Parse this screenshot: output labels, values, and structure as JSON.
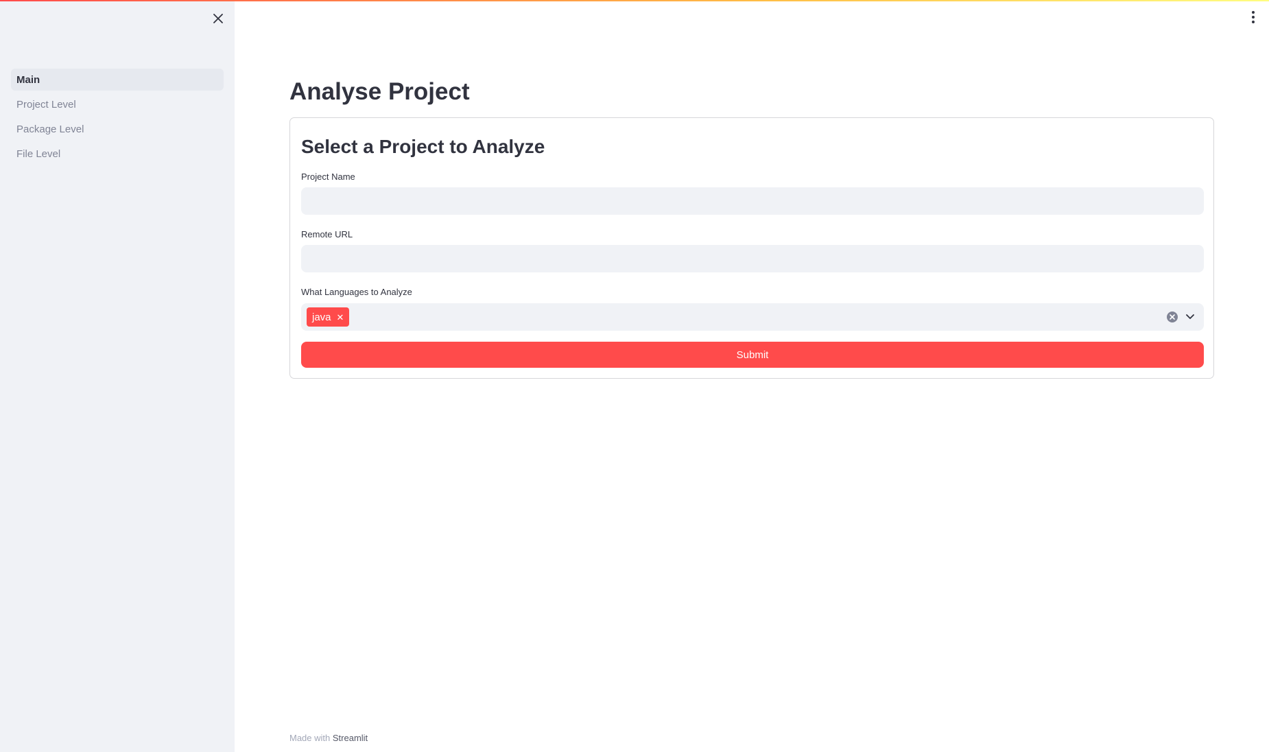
{
  "sidebar": {
    "close_icon": "close-icon",
    "items": [
      {
        "label": "Main",
        "active": true
      },
      {
        "label": "Project Level",
        "active": false
      },
      {
        "label": "Package Level",
        "active": false
      },
      {
        "label": "File Level",
        "active": false
      }
    ]
  },
  "header": {
    "menu_icon": "kebab-menu-icon",
    "gradient_colors": [
      "#ff4b4b",
      "#ffbd45",
      "#fffd80"
    ]
  },
  "main": {
    "title": "Analyse Project",
    "form": {
      "heading": "Select a Project to Analyze",
      "project_name": {
        "label": "Project Name",
        "value": "",
        "placeholder": ""
      },
      "remote_url": {
        "label": "Remote URL",
        "value": "",
        "placeholder": ""
      },
      "languages": {
        "label": "What Languages to Analyze",
        "selected": [
          "java"
        ]
      },
      "submit_label": "Submit"
    }
  },
  "footer": {
    "prefix": "Made with",
    "link": "Streamlit"
  },
  "colors": {
    "accent": "#ff4b4b",
    "sidebar_bg": "#f0f2f6",
    "text": "#31333f"
  }
}
